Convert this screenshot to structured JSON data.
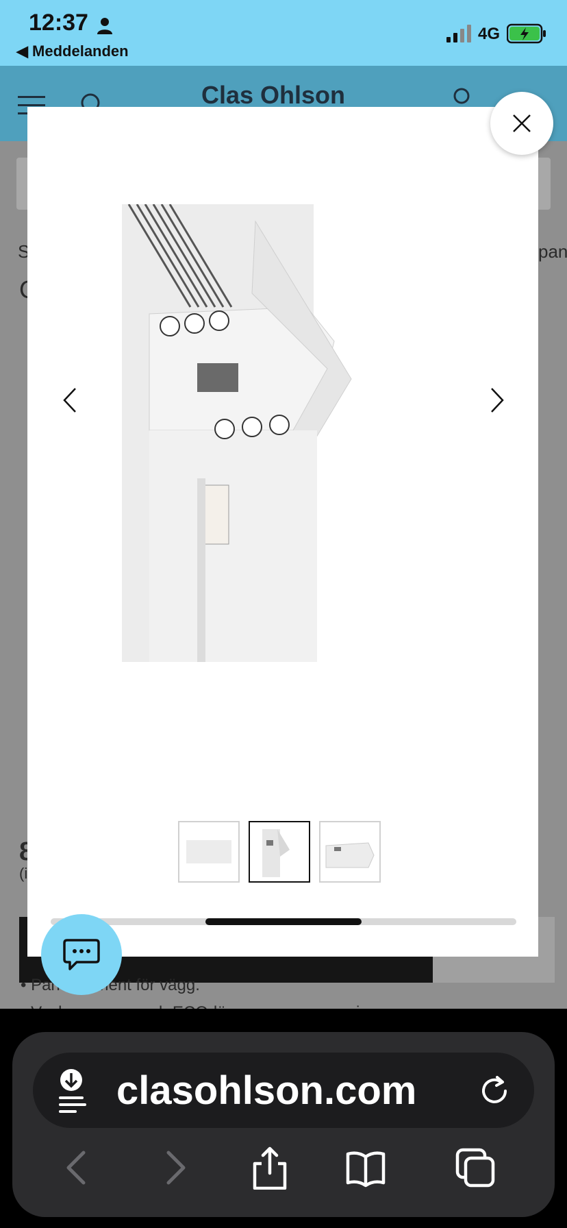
{
  "status_bar": {
    "time": "12:37",
    "back_label": "◀ Meddelanden",
    "network": "4G",
    "battery_charging": true
  },
  "site": {
    "logo": "Clas Ohlson",
    "fragments": {
      "left_s": "S",
      "right_pan": "pan",
      "left_c": "C",
      "price_8": "8",
      "paren_i": "(i"
    },
    "bullet_1": "• Panelelement för vägg.",
    "bullet_2": "• Veckoprogram och ECO-läge – sparar energi"
  },
  "modal": {
    "gallery": {
      "current_index": 2,
      "total_images": 3,
      "thumbnails": [
        {
          "name": "thumbnail-front",
          "active": false
        },
        {
          "name": "thumbnail-control-panel",
          "active": true
        },
        {
          "name": "thumbnail-top",
          "active": false
        }
      ]
    }
  },
  "browser": {
    "url": "clasohlson.com"
  },
  "icons": {
    "close": "close-icon",
    "prev": "chevron-left-icon",
    "next": "chevron-right-icon",
    "chat": "chat-bubble-icon",
    "download": "download-icon",
    "reload": "reload-icon",
    "back": "back-arrow-icon",
    "forward": "forward-arrow-icon",
    "share": "share-icon",
    "bookmarks": "book-icon",
    "tabs": "tabs-icon"
  },
  "colors": {
    "accent_light_blue": "#7ed6f5",
    "header_blue": "#4fa0bd",
    "modal_bg": "#ffffff"
  }
}
